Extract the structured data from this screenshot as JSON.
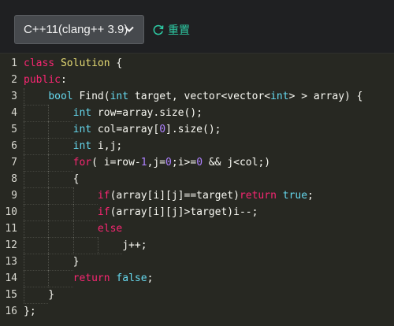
{
  "toolbar": {
    "language_label": "C++11(clang++ 3.9)",
    "reset_label": "重置",
    "accent_color": "#2dc9a3"
  },
  "icons": {
    "dropdown": "chevron-down-icon",
    "reset": "refresh-icon"
  },
  "editor": {
    "theme": "monokai",
    "lines": [
      {
        "n": "1",
        "t": "class Solution {"
      },
      {
        "n": "2",
        "t": "public:"
      },
      {
        "n": "3",
        "t": "    bool Find(int target, vector<vector<int> > array) {"
      },
      {
        "n": "4",
        "t": "        int row=array.size();"
      },
      {
        "n": "5",
        "t": "        int col=array[0].size();"
      },
      {
        "n": "6",
        "t": "        int i,j;"
      },
      {
        "n": "7",
        "t": "        for( i=row-1,j=0;i>=0 && j<col;)"
      },
      {
        "n": "8",
        "t": "        {"
      },
      {
        "n": "9",
        "t": "            if(array[i][j]==target)return true;"
      },
      {
        "n": "10",
        "t": "            if(array[i][j]>target)i--;"
      },
      {
        "n": "11",
        "t": "            else"
      },
      {
        "n": "12",
        "t": "                j++;"
      },
      {
        "n": "13",
        "t": "        }"
      },
      {
        "n": "14",
        "t": "        return false;"
      },
      {
        "n": "15",
        "t": "    }"
      },
      {
        "n": "16",
        "t": "};"
      }
    ]
  }
}
